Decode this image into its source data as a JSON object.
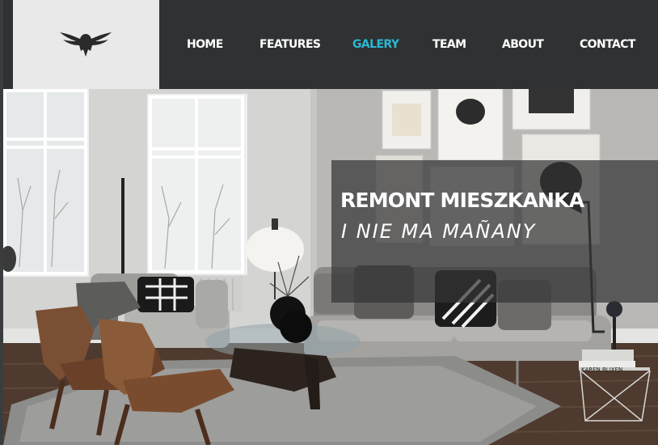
{
  "nav": {
    "items": [
      {
        "label": "HOME"
      },
      {
        "label": "FEATURES"
      },
      {
        "label": "GALERY",
        "active": true
      },
      {
        "label": "TEAM"
      },
      {
        "label": "ABOUT"
      },
      {
        "label": "CONTACT"
      }
    ]
  },
  "logo": {
    "icon": "eagle-icon"
  },
  "hero": {
    "title": "REMONT MIESZKANKA",
    "subtitle": "I NIE MA MAÑANY",
    "book_label": "KAREN BLIXEN"
  },
  "colors": {
    "header_bg": "#2f3132",
    "logo_bg": "#e9e9e9",
    "nav_text": "#ffffff",
    "nav_active": "#2bb8d2",
    "overlay_bg": "rgba(52,53,54,0.72)"
  }
}
